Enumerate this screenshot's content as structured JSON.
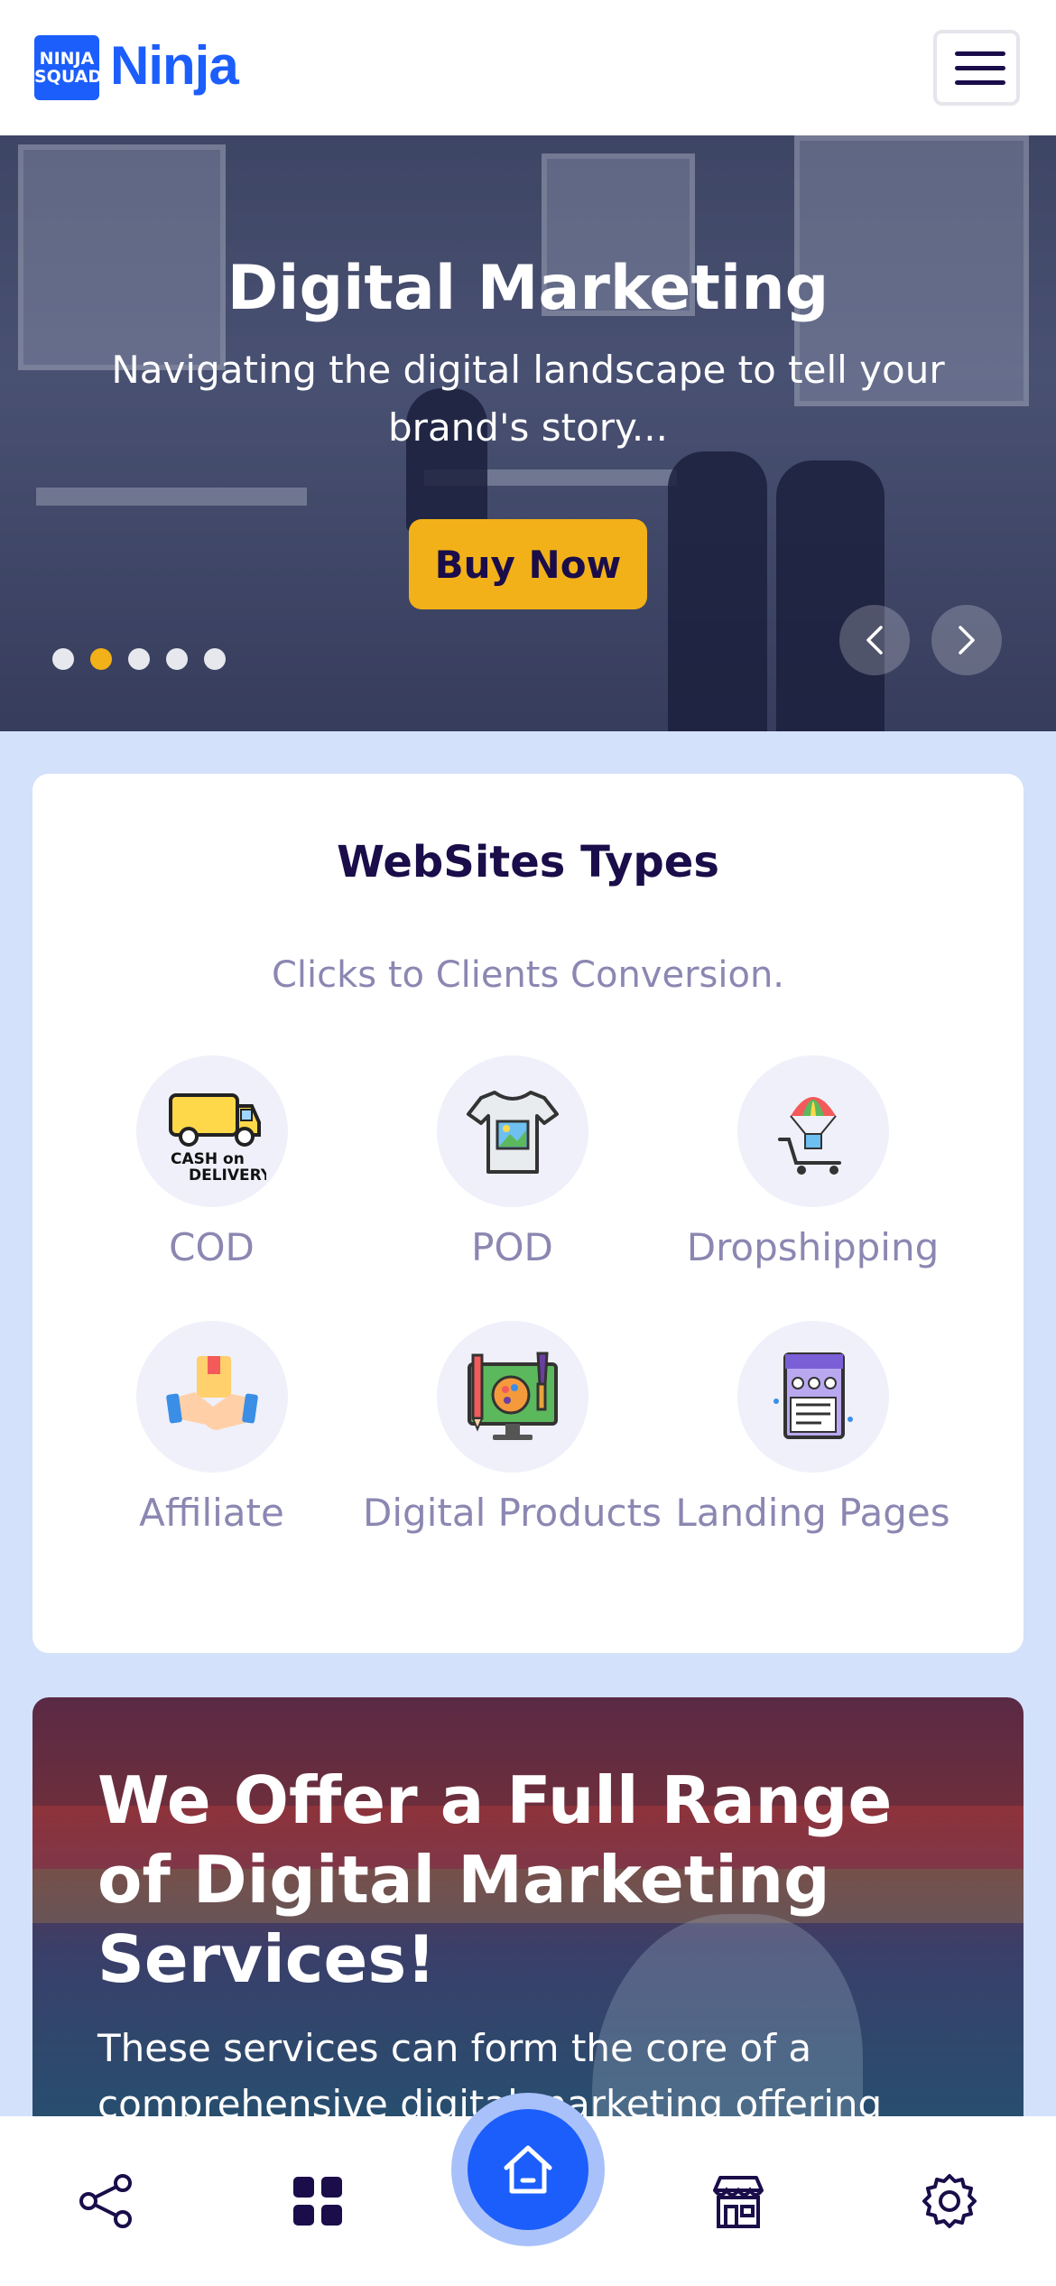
{
  "header": {
    "logo_box_line1": "NINJA",
    "logo_box_line2": "SQUAD",
    "logo_text": "Ninja"
  },
  "hero": {
    "title": "Digital Marketing",
    "subtitle": "Navigating the digital landscape to tell your brand's story...",
    "button_label": "Buy Now",
    "slide_count": 5,
    "active_slide": 2
  },
  "types": {
    "title": "WebSites Types",
    "subtitle": "Clicks to Clients Conversion.",
    "items": [
      {
        "label": "COD",
        "icon": "cash-on-delivery-truck-icon"
      },
      {
        "label": "POD",
        "icon": "tshirt-print-icon"
      },
      {
        "label": "Dropshipping",
        "icon": "parachute-cart-icon"
      },
      {
        "label": "Affiliate",
        "icon": "handshake-icon"
      },
      {
        "label": "Digital Products",
        "icon": "digital-art-icon"
      },
      {
        "label": "Landing Pages",
        "icon": "landing-page-icon"
      }
    ],
    "cod_icon_text_1": "CASH on",
    "cod_icon_text_2": "DELIVERY"
  },
  "offer": {
    "title": "We Offer a Full Range of Digital Marketing Services!",
    "text": "These services can form the core of a comprehensive digital marketing offering"
  },
  "nav": {
    "items": [
      "share-icon",
      "grid-icon",
      "home-icon",
      "store-icon",
      "settings-icon"
    ]
  },
  "colors": {
    "brand_blue": "#1c5efc",
    "accent_yellow": "#f2b118",
    "dark_navy": "#1a0d4a",
    "muted_purple": "#8b87b2",
    "page_bg": "#d3e1fb"
  }
}
